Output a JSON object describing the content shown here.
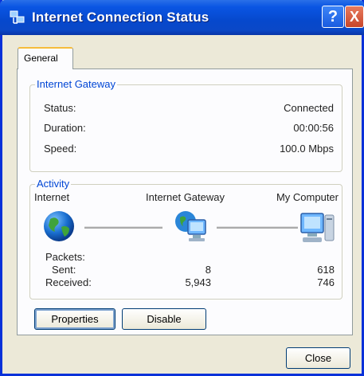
{
  "window": {
    "title": "Internet Connection Status"
  },
  "titlebar": {
    "help_glyph": "?",
    "close_glyph": "X"
  },
  "tabs": [
    {
      "label": "General"
    }
  ],
  "gateway_group": {
    "legend": "Internet Gateway",
    "rows": [
      {
        "label": "Status:",
        "value": "Connected"
      },
      {
        "label": "Duration:",
        "value": "00:00:56"
      },
      {
        "label": "Speed:",
        "value": "100.0 Mbps"
      }
    ]
  },
  "activity_group": {
    "legend": "Activity",
    "nodes": [
      {
        "label": "Internet",
        "icon": "globe-icon"
      },
      {
        "label": "Internet Gateway",
        "icon": "gateway-icon"
      },
      {
        "label": "My Computer",
        "icon": "computer-icon"
      }
    ],
    "packets_label": "Packets:",
    "sent_label": "Sent:",
    "received_label": "Received:",
    "sent_gateway": "8",
    "sent_computer": "618",
    "received_gateway": "5,943",
    "received_computer": "746"
  },
  "buttons": {
    "properties": "Properties",
    "disable": "Disable",
    "close": "Close"
  },
  "colors": {
    "title_bar": "#0a55e3",
    "group_legend": "#0046d5",
    "tab_highlight": "#f6bc3b"
  }
}
